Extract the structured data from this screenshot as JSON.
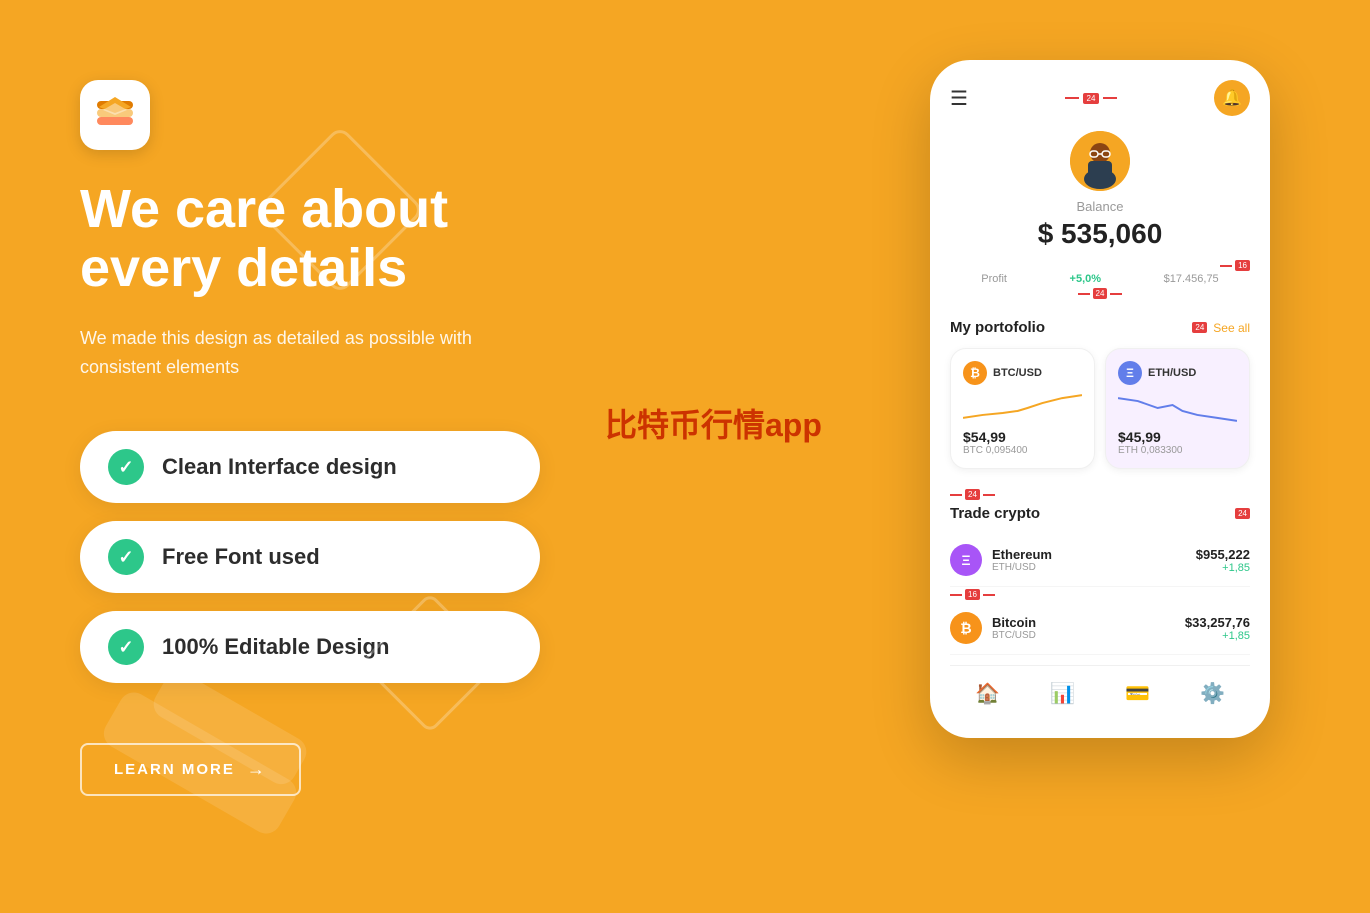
{
  "background_color": "#F5A623",
  "logo": {
    "alt": "App Logo"
  },
  "header": {
    "title_line1": "We care about",
    "title_line2": "every details",
    "subtitle": "We made this design as detailed as possible with consistent elements"
  },
  "features": [
    {
      "label": "Clean Interface design"
    },
    {
      "label": "Free Font used"
    },
    {
      "label": "100% Editable Design"
    }
  ],
  "cta": {
    "label": "LEARN MORE",
    "arrow": "→"
  },
  "watermark": "比特币行情app",
  "phone": {
    "balance_label": "Balance",
    "balance_amount": "$ 535,060",
    "profit_label": "Profit",
    "profit_pct": "+5,0%",
    "profit_value": "$17.456,75",
    "portfolio_title": "My portofolio",
    "see_all": "See all",
    "btc_pair": "BTC/USD",
    "btc_price": "$54,99",
    "btc_amount": "BTC 0,095400",
    "eth_pair": "ETH/USD",
    "eth_price": "$45,99",
    "eth_amount": "ETH 0,083300",
    "trade_title": "Trade crypto",
    "trade_items": [
      {
        "name": "Ethereum",
        "pair": "ETH/USD",
        "price": "$955,222",
        "change": "+1,85"
      },
      {
        "name": "Bitcoin",
        "pair": "BTC/USD",
        "price": "$33,257,76",
        "change": "+1,85"
      }
    ],
    "nav": [
      "🏠",
      "📊",
      "💳",
      "⚙️"
    ],
    "measurement_tags": [
      "16",
      "24",
      "24",
      "24",
      "24",
      "16"
    ]
  }
}
